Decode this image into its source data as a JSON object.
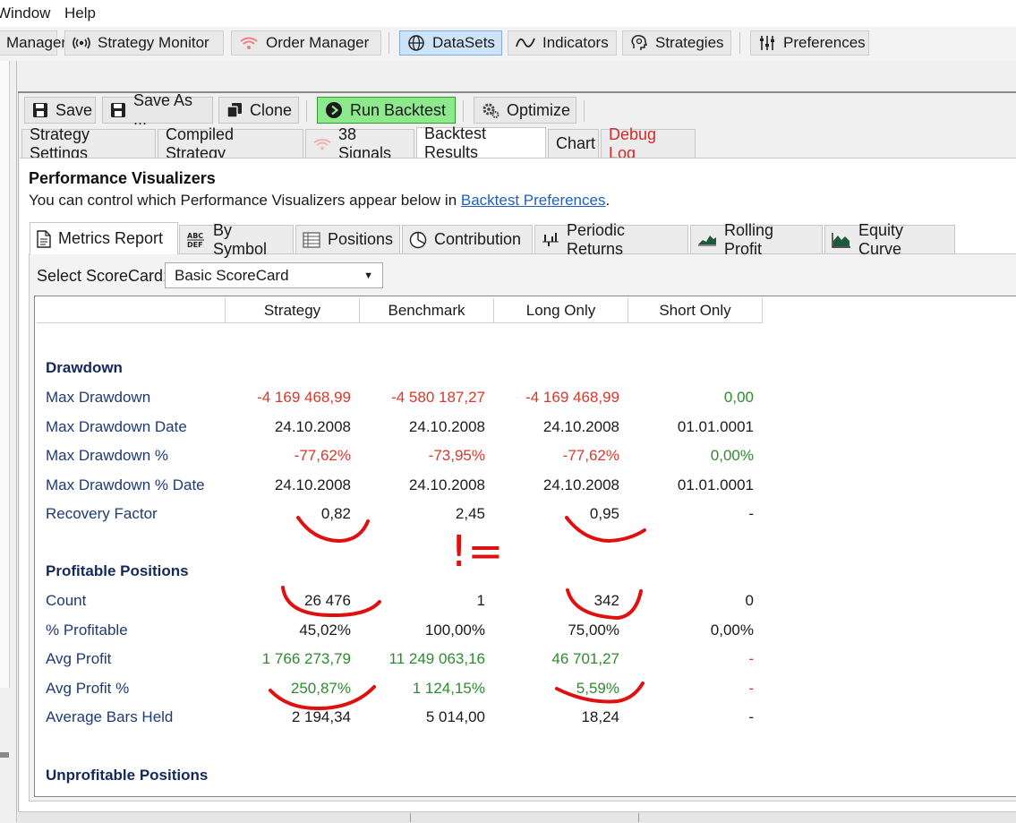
{
  "menubar": {
    "items": [
      "Window",
      "Help"
    ]
  },
  "toolbar": {
    "buttons": [
      {
        "label": "Manager",
        "icon": "manager-icon"
      },
      {
        "label": "Strategy Monitor",
        "icon": "broadcast-icon"
      },
      {
        "label": "Order Manager",
        "icon": "wifi-signal-icon"
      },
      {
        "label": "DataSets",
        "icon": "globe-icon",
        "active": true
      },
      {
        "label": "Indicators",
        "icon": "wave-icon"
      },
      {
        "label": "Strategies",
        "icon": "brain-head-icon"
      },
      {
        "label": "Preferences",
        "icon": "sliders-icon"
      }
    ]
  },
  "strategy_toolbar": {
    "save": "Save",
    "save_as": "Save As ...",
    "clone": "Clone",
    "run_backtest": "Run Backtest",
    "optimize": "Optimize"
  },
  "main_tabs": [
    {
      "label": "Strategy Settings"
    },
    {
      "label": "Compiled Strategy"
    },
    {
      "label": "38 Signals"
    },
    {
      "label": "Backtest Results",
      "active": true
    },
    {
      "label": "Chart"
    },
    {
      "label": "Debug Log",
      "color": "#d22b2b"
    }
  ],
  "visualizers": {
    "title": "Performance Visualizers",
    "desc_prefix": "You can control which Performance Visualizers appear below in ",
    "desc_link": "Backtest Preferences",
    "desc_suffix": ".",
    "tabs": [
      "Metrics Report",
      "By Symbol",
      "Positions",
      "Contribution",
      "Periodic Returns",
      "Rolling Profit",
      "Equity Curve"
    ]
  },
  "scorecard": {
    "label": "Select ScoreCard:",
    "value": "Basic ScoreCard"
  },
  "grid": {
    "columns": [
      "Strategy",
      "Benchmark",
      "Long Only",
      "Short Only"
    ],
    "sections": [
      {
        "title": "Drawdown",
        "rows": [
          {
            "label": "Max Drawdown",
            "values": [
              "-4 169 468,99",
              "-4 580 187,27",
              "-4 169 468,99",
              "0,00"
            ],
            "colors": [
              "neg",
              "neg",
              "neg",
              "pos"
            ]
          },
          {
            "label": "Max Drawdown Date",
            "values": [
              "24.10.2008",
              "24.10.2008",
              "24.10.2008",
              "01.01.0001"
            ],
            "colors": [
              "blk",
              "blk",
              "blk",
              "blk"
            ]
          },
          {
            "label": "Max Drawdown %",
            "values": [
              "-77,62%",
              "-73,95%",
              "-77,62%",
              "0,00%"
            ],
            "colors": [
              "neg",
              "neg",
              "neg",
              "pos"
            ]
          },
          {
            "label": "Max Drawdown % Date",
            "values": [
              "24.10.2008",
              "24.10.2008",
              "24.10.2008",
              "01.01.0001"
            ],
            "colors": [
              "blk",
              "blk",
              "blk",
              "blk"
            ]
          },
          {
            "label": "Recovery Factor",
            "values": [
              "0,82",
              "2,45",
              "0,95",
              "-"
            ],
            "colors": [
              "blk",
              "blk",
              "blk",
              "blk"
            ]
          }
        ]
      },
      {
        "title": "Profitable Positions",
        "rows": [
          {
            "label": "Count",
            "values": [
              "26 476",
              "1",
              "342",
              "0"
            ],
            "colors": [
              "blk",
              "blk",
              "blk",
              "blk"
            ]
          },
          {
            "label": "% Profitable",
            "values": [
              "45,02%",
              "100,00%",
              "75,00%",
              "0,00%"
            ],
            "colors": [
              "blk",
              "blk",
              "blk",
              "blk"
            ]
          },
          {
            "label": "Avg Profit",
            "values": [
              "1 766 273,79",
              "11 249 063,16",
              "46 701,27",
              "-"
            ],
            "colors": [
              "pos",
              "pos",
              "pos",
              "neg"
            ]
          },
          {
            "label": "Avg Profit %",
            "values": [
              "250,87%",
              "1 124,15%",
              "5,59%",
              "-"
            ],
            "colors": [
              "pos",
              "pos",
              "pos",
              "neg"
            ]
          },
          {
            "label": "Average Bars Held",
            "values": [
              "2 194,34",
              "5 014,00",
              "18,24",
              "-"
            ],
            "colors": [
              "blk",
              "blk",
              "blk",
              "blk"
            ]
          }
        ]
      },
      {
        "title": "Unprofitable Positions",
        "rows": []
      }
    ]
  },
  "annotation": {
    "text": "!=",
    "color": "#e01010"
  }
}
